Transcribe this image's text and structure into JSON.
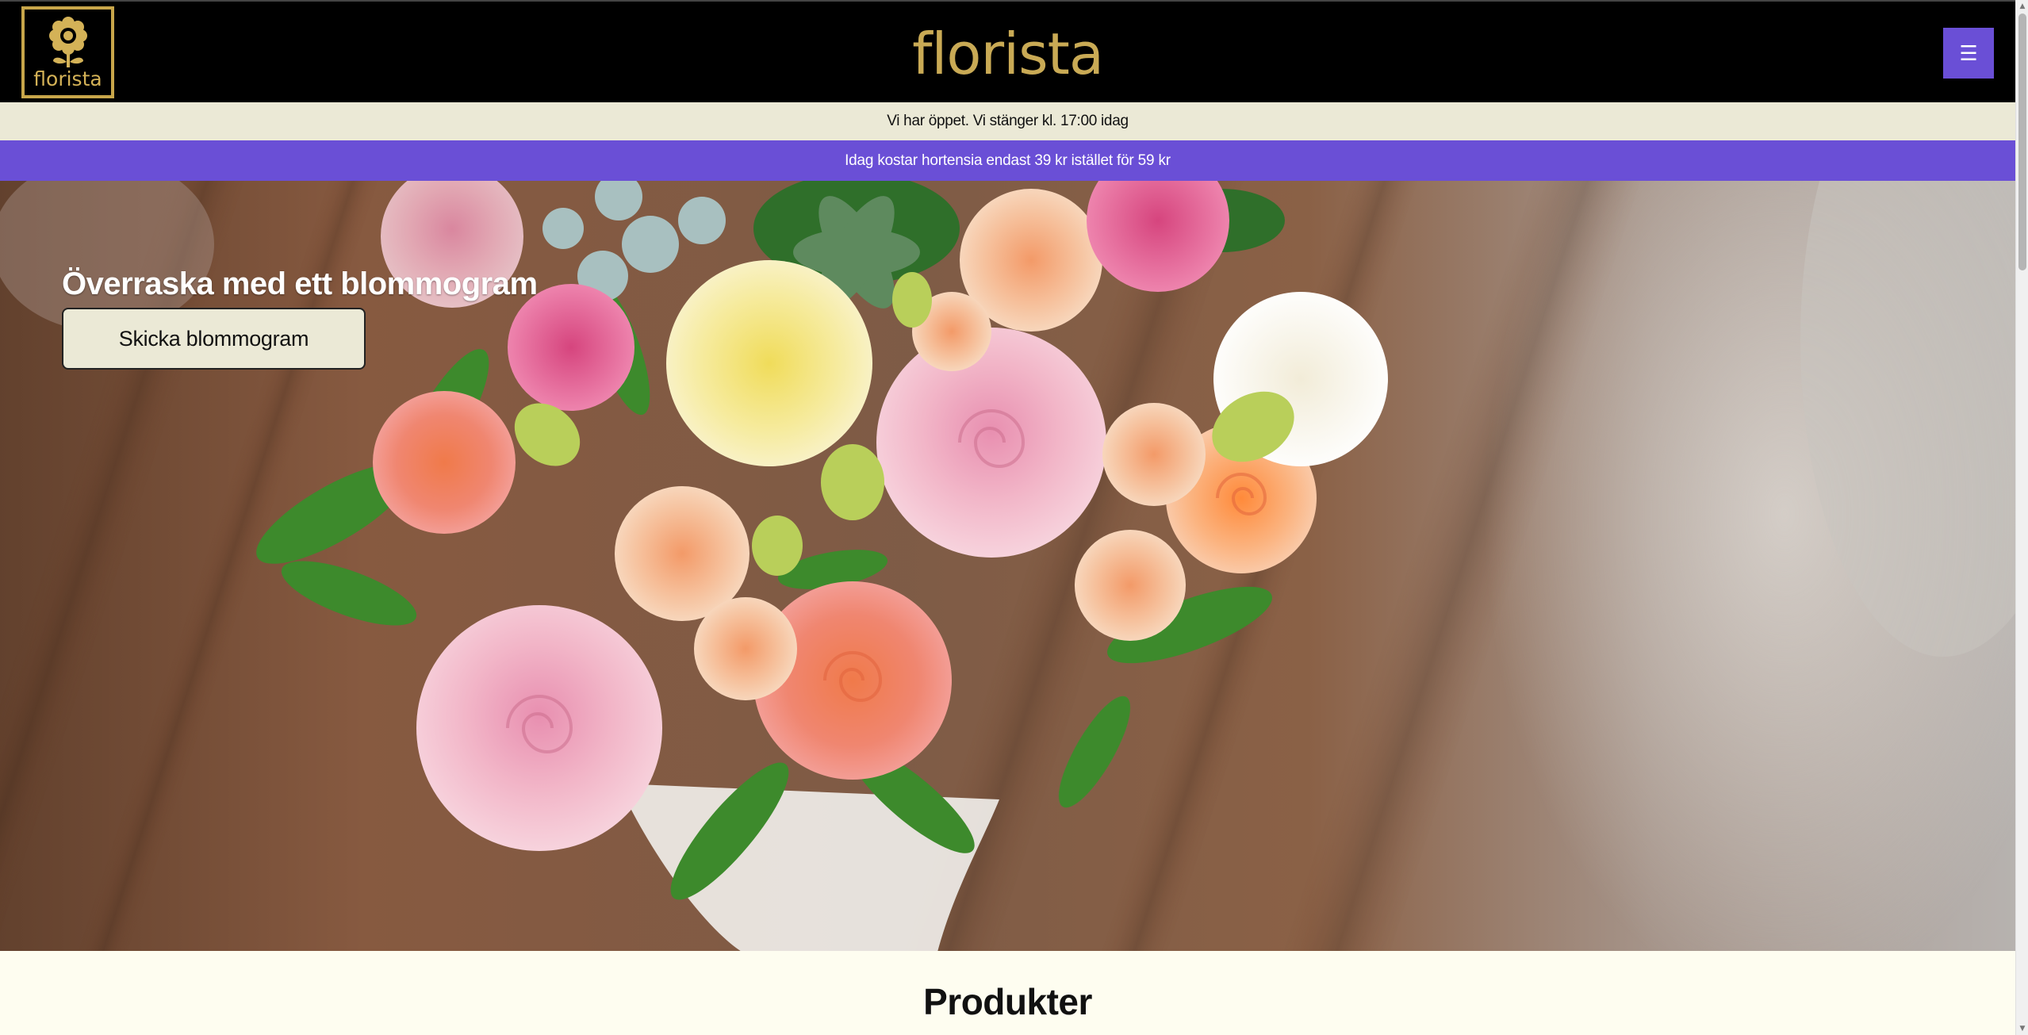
{
  "header": {
    "logo_text": "florista",
    "brand_title": "florista",
    "menu_icon": "☰"
  },
  "info": {
    "opening_text": "Vi har öppet. Vi stänger kl. 17:00 idag",
    "offer_text": "Idag kostar hortensia endast 39 kr istället för 59 kr"
  },
  "hero": {
    "heading": "Överraska med ett blommogram",
    "button_label": "Skicka blommogram"
  },
  "products": {
    "heading": "Produkter"
  },
  "scrollbar": {
    "up_icon": "▲",
    "down_icon": "▼"
  },
  "colors": {
    "header_bg": "#000000",
    "brand_gold": "#c9aa55",
    "accent_purple": "#6a4fd6",
    "cream": "#ebe9d6",
    "page_bg": "#fefdf0"
  }
}
